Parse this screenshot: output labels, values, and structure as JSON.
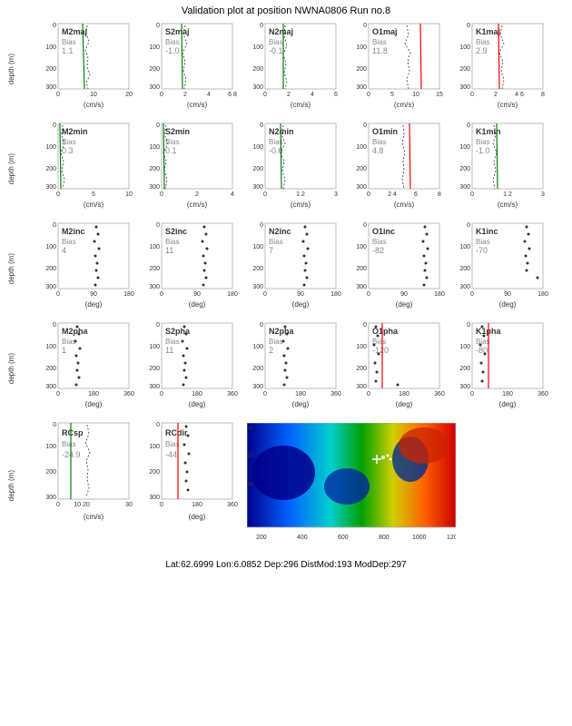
{
  "title": "Validation plot at position NWNA0806 Run no.8",
  "footer": "Lat:62.6999  Lon:6.0852  Dep:296  DistMod:193  ModDep:297",
  "rows": [
    {
      "ylabel": "depth (m)",
      "plots": [
        {
          "label": "M2maj",
          "bias": "Bias",
          "val": "1.1",
          "xmin": "0",
          "xmax": "20",
          "unit": "(cm/s)",
          "color": "green",
          "redline": false
        },
        {
          "label": "S2maj",
          "bias": "Bias",
          "val": "-1.0",
          "xmin": "0",
          "xmax": "8",
          "unit": "(cm/s)",
          "color": "green",
          "redline": false
        },
        {
          "label": "N2maj",
          "bias": "Bias",
          "val": "-0.1",
          "xmin": "0",
          "xmax": "6",
          "unit": "(cm/s)",
          "color": "green",
          "redline": false
        },
        {
          "label": "O1maj",
          "bias": "Bias",
          "val": "11.8",
          "xmin": "0",
          "xmax": "15",
          "unit": "(cm/s)",
          "color": "red",
          "redline": true
        },
        {
          "label": "K1maj",
          "bias": "Bias",
          "val": "2.9",
          "xmin": "0",
          "xmax": "8",
          "unit": "(cm/s)",
          "color": "red",
          "redline": true
        }
      ]
    },
    {
      "ylabel": "depth (m)",
      "plots": [
        {
          "label": "M2min",
          "bias": "Bias",
          "val": "0.3",
          "xmin": "0",
          "xmax": "10",
          "unit": "(cm/s)",
          "color": "green",
          "redline": false
        },
        {
          "label": "S2min",
          "bias": "Bias",
          "val": "0.1",
          "xmin": "0",
          "xmax": "4",
          "unit": "(cm/s)",
          "color": "green",
          "redline": false
        },
        {
          "label": "N2min",
          "bias": "Bias",
          "val": "-0.6",
          "xmin": "0",
          "xmax": "3",
          "unit": "(cm/s)",
          "color": "green",
          "redline": false
        },
        {
          "label": "O1min",
          "bias": "Bias",
          "val": "4.8",
          "xmin": "0",
          "xmax": "8",
          "unit": "(cm/s)",
          "color": "red",
          "redline": true
        },
        {
          "label": "K1min",
          "bias": "Bias",
          "val": "-1.0",
          "xmin": "0",
          "xmax": "3",
          "unit": "(cm/s)",
          "color": "green",
          "redline": false
        }
      ]
    },
    {
      "ylabel": "depth (m)",
      "plots": [
        {
          "label": "M2inc",
          "bias": "Bias",
          "val": "4",
          "xmin": "0",
          "xmax": "180",
          "unit": "(deg)",
          "color": "green",
          "redline": false
        },
        {
          "label": "S2inc",
          "bias": "Bias",
          "val": "11",
          "xmin": "0",
          "xmax": "180",
          "unit": "(deg)",
          "color": "green",
          "redline": false
        },
        {
          "label": "N2inc",
          "bias": "Bias",
          "val": "7",
          "xmin": "0",
          "xmax": "180",
          "unit": "(deg)",
          "color": "green",
          "redline": false
        },
        {
          "label": "O1inc",
          "bias": "Bias",
          "val": "-82",
          "xmin": "0",
          "xmax": "180",
          "unit": "(deg)",
          "color": "green",
          "redline": false
        },
        {
          "label": "K1inc",
          "bias": "Bias",
          "val": "-70",
          "xmin": "0",
          "xmax": "180",
          "unit": "(deg)",
          "color": "green",
          "redline": false
        }
      ]
    },
    {
      "ylabel": "depth (m)",
      "plots": [
        {
          "label": "M2pha",
          "bias": "Bias",
          "val": "1",
          "xmin": "0",
          "xmax": "360",
          "unit": "(deg)",
          "color": "green",
          "redline": false
        },
        {
          "label": "S2pha",
          "bias": "Bias",
          "val": "11",
          "xmin": "0",
          "xmax": "360",
          "unit": "(deg)",
          "color": "green",
          "redline": false
        },
        {
          "label": "N2pha",
          "bias": "Bias",
          "val": "2",
          "xmin": "0",
          "xmax": "360",
          "unit": "(deg)",
          "color": "green",
          "redline": false
        },
        {
          "label": "O1pha",
          "bias": "Bias",
          "val": "-120",
          "xmin": "0",
          "xmax": "360",
          "unit": "(deg)",
          "color": "red",
          "redline": true
        },
        {
          "label": "K1pha",
          "bias": "Bias",
          "val": "-80",
          "xmin": "0",
          "xmax": "360",
          "unit": "(deg)",
          "color": "red",
          "redline": true
        }
      ]
    }
  ],
  "bottom": {
    "ylabel": "depth (m)",
    "plots": [
      {
        "label": "RCsp",
        "bias": "Bias",
        "val": "-24.9",
        "xmin": "0",
        "xmax": "30",
        "unit": "(cm/s)",
        "color": "green",
        "redline": false
      },
      {
        "label": "RCdir",
        "bias": "Bias",
        "val": "-44",
        "xmin": "0",
        "xmax": "360",
        "unit": "(deg)",
        "color": "red",
        "redline": true
      }
    ]
  },
  "xtick_labels_maj": [
    "0",
    "10",
    "20"
  ],
  "xtick_labels_deg180": [
    "0",
    "90",
    "180"
  ],
  "xtick_labels_deg360": [
    "0",
    "180",
    "360"
  ]
}
